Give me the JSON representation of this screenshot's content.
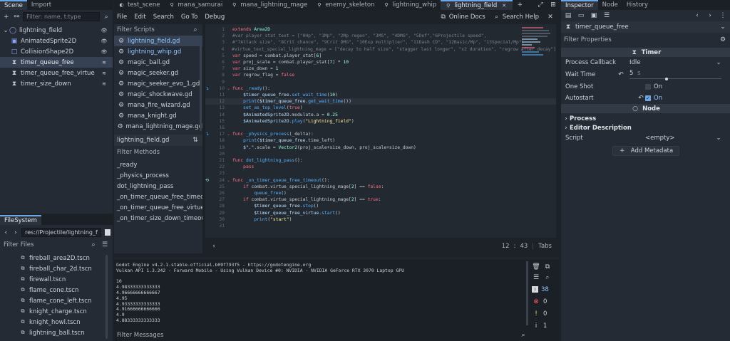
{
  "left_dock": {
    "tabs": [
      "Scene",
      "Import"
    ],
    "filter_placeholder": "Filter: name, t:type",
    "tree": [
      {
        "label": "lightning_field",
        "indent": 0,
        "selected": false,
        "icon": "area2d-icon"
      },
      {
        "label": "AnimatedSprite2D",
        "indent": 1,
        "selected": false,
        "icon": "animated-sprite-icon"
      },
      {
        "label": "CollisionShape2D",
        "indent": 1,
        "selected": false,
        "icon": "collision-shape-icon"
      },
      {
        "label": "timer_queue_free",
        "indent": 1,
        "selected": true,
        "icon": "timer-icon"
      },
      {
        "label": "timer_queue_free_virtue",
        "indent": 1,
        "selected": false,
        "icon": "timer-icon"
      },
      {
        "label": "timer_size_down",
        "indent": 1,
        "selected": false,
        "icon": "timer-icon"
      }
    ],
    "filesystem": {
      "title": "FileSystem",
      "path": "res://Projectile/lightning_field.",
      "filter_placeholder": "Filter Files",
      "files": [
        "fireball_area2D.tscn",
        "fireball_char_2d.tscn",
        "firewall.tscn",
        "flame_cone.tscn",
        "flame_cone_left.tscn",
        "knight_charge.tscn",
        "knight_howl.tscn",
        "lightning_ball.tscn"
      ]
    }
  },
  "editor": {
    "tabs": [
      {
        "label": "test_scene",
        "active": false
      },
      {
        "label": "mana_samurai",
        "active": false
      },
      {
        "label": "mana_lightning_mage",
        "active": false
      },
      {
        "label": "enemy_skeleton",
        "active": false
      },
      {
        "label": "lightning_whip",
        "active": false
      },
      {
        "label": "lightning_field",
        "active": true
      }
    ],
    "menu": [
      "File",
      "Edit",
      "Search",
      "Go To",
      "Debug"
    ],
    "online_docs": "Online Docs",
    "search_help": "Search Help",
    "filter_scripts": "Filter Scripts",
    "scripts": [
      {
        "label": "lightning_field.gd",
        "selected": true
      },
      {
        "label": "lightning_whip.gd",
        "selected": false
      },
      {
        "label": "magic_ball.gd",
        "selected": false
      },
      {
        "label": "magic_seeker.gd",
        "selected": false
      },
      {
        "label": "magic_seeker_evo_1.gd",
        "selected": false
      },
      {
        "label": "magic_shockwave.gd",
        "selected": false
      },
      {
        "label": "mana_fire_wizard.gd",
        "selected": false
      },
      {
        "label": "mana_knight.gd",
        "selected": false
      },
      {
        "label": "mana_lightning_mage.gd",
        "selected": false
      }
    ],
    "current_script": "lightning_field.gd",
    "filter_methods": "Filter Methods",
    "methods": [
      "_ready",
      "_physics_process",
      "dot_lightning_pass",
      "_on_timer_queue_free_timeout",
      "_on_timer_queue_free_virtue_ti...",
      "_on_timer_size_down_timeout"
    ],
    "cursor_line": "12",
    "cursor_col": "43",
    "indent_mode": "Tabs",
    "code_lines": [
      {
        "n": "1",
        "html": "<span class='k'>extends</span> <span class='t'>Area2D</span>"
      },
      {
        "n": "2",
        "html": "<span class='c'>#var player_stat_text = [\"0Hp\", \"1Mp\", \"2Mp regen\", \"3MS\", \"4DMG\", \"5Def\",\"6Projectile speed\",</span>"
      },
      {
        "n": "3",
        "html": "<span class='c'>#\"7Attack size\", \"8Crit chance\", \"9Crit DMG\", \"10Exp multiplier\", \"11Dash CD\", \"12Basic/Mp\", \"13Special/Mp\"]</span>"
      },
      {
        "n": "4",
        "html": "<span class='c'>#virtue_text_special_lightning_mage = [\"decay to half size\", \"stagger last longer\", \"x2 duration\", \"regrow after decay\"]</span>"
      },
      {
        "n": "5",
        "html": "<span class='k'>var</span> speed = combat.player_stat[<span class='n'>6</span>]"
      },
      {
        "n": "6",
        "html": "<span class='k'>var</span> proj_scale = combat.player_stat[<span class='n'>7</span>] * <span class='n'>10</span>"
      },
      {
        "n": "7",
        "html": "<span class='k'>var</span> size_down = <span class='n'>1</span>"
      },
      {
        "n": "8",
        "html": "<span class='k'>var</span> regrow_flag = <span class='k'>false</span>"
      },
      {
        "n": "9",
        "html": ""
      },
      {
        "n": "10",
        "html": "<span class='k'>func</span> <span class='f'>_ready</span>():"
      },
      {
        "n": "11",
        "html": "    <span class='v'>$timer_queue_free</span>.<span class='f'>set_wait_time</span>(<span class='n'>10</span>)"
      },
      {
        "n": "12",
        "html": "    <span class='f'>print</span>(<span class='v'>$timer_queue_free</span>.<span class='f'>get_wait_time</span>())"
      },
      {
        "n": "13",
        "html": "    <span class='f'>set_as_top_level</span>(<span class='k'>true</span>)"
      },
      {
        "n": "14",
        "html": "    <span class='v'>$AnimatedSprite2D</span>.modulate.a = <span class='n'>0.25</span>"
      },
      {
        "n": "15",
        "html": "    <span class='v'>$AnimatedSprite2D</span>.<span class='f'>play</span>(<span class='s'>\"Lightning_field\"</span>)"
      },
      {
        "n": "16",
        "html": ""
      },
      {
        "n": "17",
        "html": "<span class='k'>func</span> <span class='f'>_physics_process</span>(_delta):"
      },
      {
        "n": "18",
        "html": "    <span class='f'>print</span>(<span class='v'>$timer_queue_free</span>.time_left)"
      },
      {
        "n": "19",
        "html": "    <span class='v'>$\".\"</span>.scale = <span class='t'>Vector2</span>(proj_scale+size_down, proj_scale+size_down)"
      },
      {
        "n": "20",
        "html": ""
      },
      {
        "n": "21",
        "html": "<span class='k'>func</span> <span class='f'>dot_lightning_pass</span>():"
      },
      {
        "n": "22",
        "html": "    <span class='k'>pass</span>"
      },
      {
        "n": "23",
        "html": ""
      },
      {
        "n": "24",
        "html": "<span class='k'>func</span> <span class='f'>_on_timer_queue_free_timeout</span>():"
      },
      {
        "n": "25",
        "html": "    <span class='k'>if</span> combat.virtue_special_lightning_mage[<span class='n'>2</span>] == <span class='k'>false</span>:"
      },
      {
        "n": "26",
        "html": "        <span class='f'>queue_free</span>()"
      },
      {
        "n": "27",
        "html": "    <span class='k'>if</span> combat.virtue_special_lightning_mage[<span class='n'>2</span>] == <span class='k'>true</span>:"
      },
      {
        "n": "28",
        "html": "        <span class='v'>$timer_queue_free</span>.<span class='f'>stop</span>()"
      },
      {
        "n": "29",
        "html": "        <span class='v'>$timer_queue_free_virtue</span>.<span class='f'>start</span>()"
      },
      {
        "n": "30",
        "html": "        <span class='f'>print</span>(<span class='s'>\"start\"</span>)"
      },
      {
        "n": "31",
        "html": ""
      }
    ]
  },
  "output": {
    "lines": [
      "Godot Engine v4.2.1.stable.official.b09f793f5 - https://godotengine.org",
      "Vulkan API 1.3.242 - Forward Mobile - Using Vulkan Device #0: NVIDIA - NVIDIA GeForce RTX 3070 Laptop GPU",
      "",
      "10",
      "4.98333333333333",
      "4.96666666666667",
      "4.95",
      "4.93333333333333",
      "4.91666666666666",
      "4.9",
      "4.88333333333333"
    ],
    "filter_placeholder": "Filter Messages",
    "counts": {
      "messages": "38",
      "errors": "0",
      "warnings": "0",
      "other": "1"
    }
  },
  "inspector": {
    "tabs": [
      "Inspector",
      "Node",
      "History"
    ],
    "node_name": "timer_queue_free",
    "filter_placeholder": "Filter Properties",
    "timer_section": "Timer",
    "process_callback_label": "Process Callback",
    "process_callback_value": "Idle",
    "wait_time_label": "Wait Time",
    "wait_time_value": "5",
    "wait_time_unit": "s",
    "one_shot_label": "One Shot",
    "one_shot_value": "On",
    "autostart_label": "Autostart",
    "autostart_value": "On",
    "node_section": "Node",
    "process_label": "Process",
    "editor_description_label": "Editor Description",
    "script_label": "Script",
    "script_value": "<empty>",
    "add_metadata": "Add Metadata"
  }
}
